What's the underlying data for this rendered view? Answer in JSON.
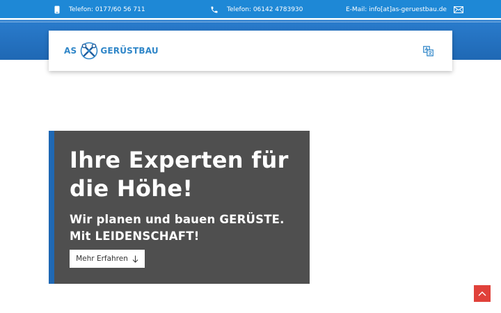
{
  "topbar": {
    "mobile_text": "Telefon: 0177/60 56 711",
    "phone_text": "Telefon: 06142 4783930",
    "email_text": "E-Mail: info[at]as-geruestbau.de",
    "mobile_icon": "mobile-phone-icon",
    "phone_icon": "phone-icon",
    "email_icon": "envelope-icon"
  },
  "header": {
    "logo_left": "AS",
    "logo_right": "GERÜSTBAU",
    "translate_icon": "translate-icon"
  },
  "hero": {
    "title": "Ihre Experten für die Höhe!",
    "subtitle": "Wir planen und bauen GERÜSTE. Mit LEIDENSCHAFT!",
    "button_label": "Mehr Erfahren"
  },
  "colors": {
    "primary_blue": "#1e88d6",
    "dark_blue": "#1f68b4",
    "hero_bg": "#4f4f4f",
    "scroll_top_red": "#e0413a"
  }
}
